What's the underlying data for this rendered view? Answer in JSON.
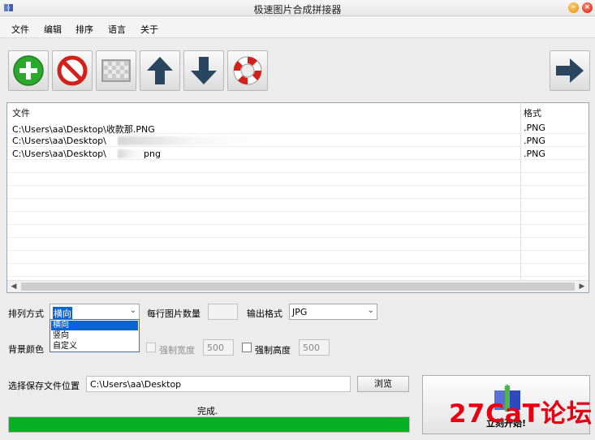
{
  "window": {
    "title": "极速图片合成拼接器"
  },
  "menu": {
    "items": [
      "文件",
      "编辑",
      "排序",
      "语言",
      "关于"
    ]
  },
  "toolbar": {
    "buttons": [
      {
        "name": "add-button",
        "icon": "plus-circle-icon",
        "color": "#2ca82c"
      },
      {
        "name": "remove-button",
        "icon": "no-entry-icon",
        "color": "#d4201a"
      },
      {
        "name": "clear-button",
        "icon": "checkerboard-icon",
        "color": "#9a9a9a"
      },
      {
        "name": "move-up-button",
        "icon": "arrow-up-icon",
        "color": "#2a4560"
      },
      {
        "name": "move-down-button",
        "icon": "arrow-down-icon",
        "color": "#2a4560"
      },
      {
        "name": "help-button",
        "icon": "lifebuoy-icon",
        "color": "#d4201a"
      },
      {
        "name": "next-button",
        "icon": "arrow-right-icon",
        "color": "#2a4560"
      }
    ]
  },
  "file_list": {
    "columns": [
      "文件",
      "格式"
    ],
    "rows": [
      {
        "path": "C:\\Users\\aa\\Desktop\\收款那.PNG",
        "format": ".PNG"
      },
      {
        "path": "C:\\Users\\aa\\Desktop\\",
        "format": ".PNG"
      },
      {
        "path": "C:\\Users\\aa\\Desktop\\",
        "path_suffix": "png",
        "format": ".PNG"
      }
    ]
  },
  "settings": {
    "arrange_label": "排列方式",
    "arrange_value": "横向",
    "arrange_options": [
      "横向",
      "竖向",
      "自定义"
    ],
    "per_row_label": "每行图片数量",
    "per_row_value": "",
    "output_format_label": "输出格式",
    "output_format_value": "JPG",
    "bg_color_label": "背景颜色",
    "force_width_label": "强制宽度",
    "force_width_value": "500",
    "force_height_label": "强制高度",
    "force_height_value": "500"
  },
  "save": {
    "label": "选择保存文件位置",
    "path": "C:\\Users\\aa\\Desktop",
    "browse_label": "浏览"
  },
  "status": {
    "text": "完成.",
    "progress": 1.0,
    "progress_color": "#06b025"
  },
  "start": {
    "label": "立刻开始!"
  },
  "watermark": {
    "text": "27CaT论坛"
  }
}
